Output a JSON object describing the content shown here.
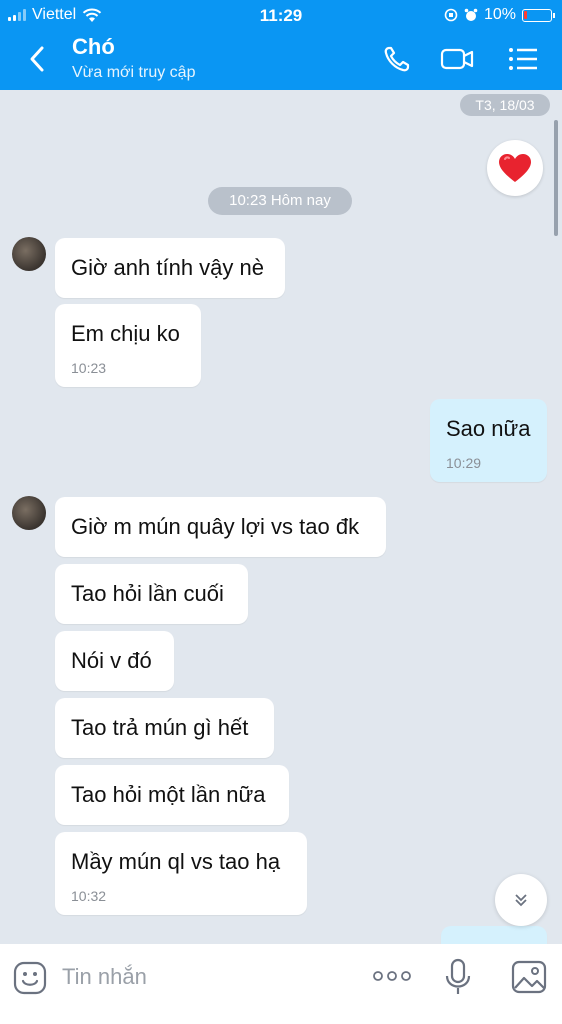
{
  "status_bar": {
    "carrier": "Viettel",
    "time": "11:29",
    "battery": "10%"
  },
  "header": {
    "title": "Chó",
    "subtitle": "Vừa mới truy cập",
    "icons": [
      "back-icon",
      "phone-icon",
      "video-call-icon",
      "menu-icon"
    ]
  },
  "chat": {
    "date_chip": "T3, 18/03",
    "time_chip": "10:23 Hôm nay",
    "sticker": "heart-icon",
    "messages": [
      {
        "from": "them",
        "text": "Giờ anh tính vậy nè",
        "time": ""
      },
      {
        "from": "them",
        "text": "Em chịu ko",
        "time": "10:23"
      },
      {
        "from": "me",
        "text": "Sao nữa",
        "time": "10:29"
      },
      {
        "from": "them",
        "text": "Giờ m mún quây lợi vs tao đk",
        "time": ""
      },
      {
        "from": "them",
        "text": "Tao hỏi lần cuối",
        "time": ""
      },
      {
        "from": "them",
        "text": "Nói v đó",
        "time": ""
      },
      {
        "from": "them",
        "text": "Tao trả mún gì hết",
        "time": ""
      },
      {
        "from": "them",
        "text": "Tao hỏi một lần nữa",
        "time": ""
      },
      {
        "from": "them",
        "text": "Mầy mún ql vs tao hạ",
        "time": "10:32"
      }
    ]
  },
  "composer": {
    "placeholder": "Tin nhắn",
    "icons": [
      "emoji-icon",
      "more-icon",
      "mic-icon",
      "gallery-icon"
    ]
  },
  "colors": {
    "header_bg": "#0a96f3",
    "chat_bg": "#e1e7ee",
    "my_bubble": "#d5f1fd",
    "their_bubble": "#ffffff"
  }
}
